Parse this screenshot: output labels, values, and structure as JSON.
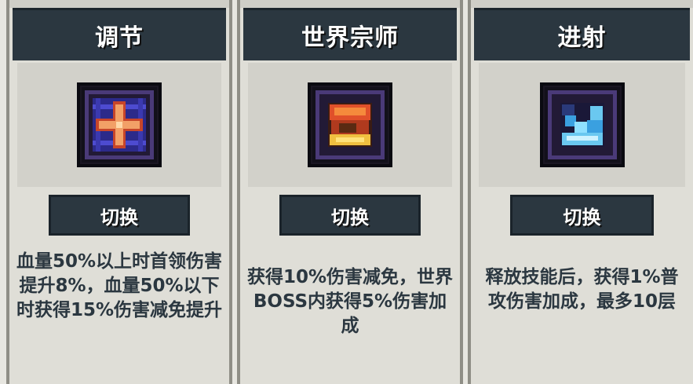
{
  "cards": [
    {
      "title": "调节",
      "icon": "cross-heal-icon",
      "button": "切换",
      "description": "血量50%以上时首领伤害提升8%，血量50%以下时获得15%伤害减免提升"
    },
    {
      "title": "世界宗师",
      "icon": "fire-master-icon",
      "button": "切换",
      "description": "获得10%伤害减免，世界BOSS内获得5%伤害加成"
    },
    {
      "title": "进射",
      "icon": "ice-burst-icon",
      "button": "切换",
      "description": "释放技能后，获得1%普攻伤害加成，最多10层"
    }
  ],
  "colors": {
    "header": "#2b3740",
    "panel": "#dfded7",
    "text": "#2b3740"
  }
}
